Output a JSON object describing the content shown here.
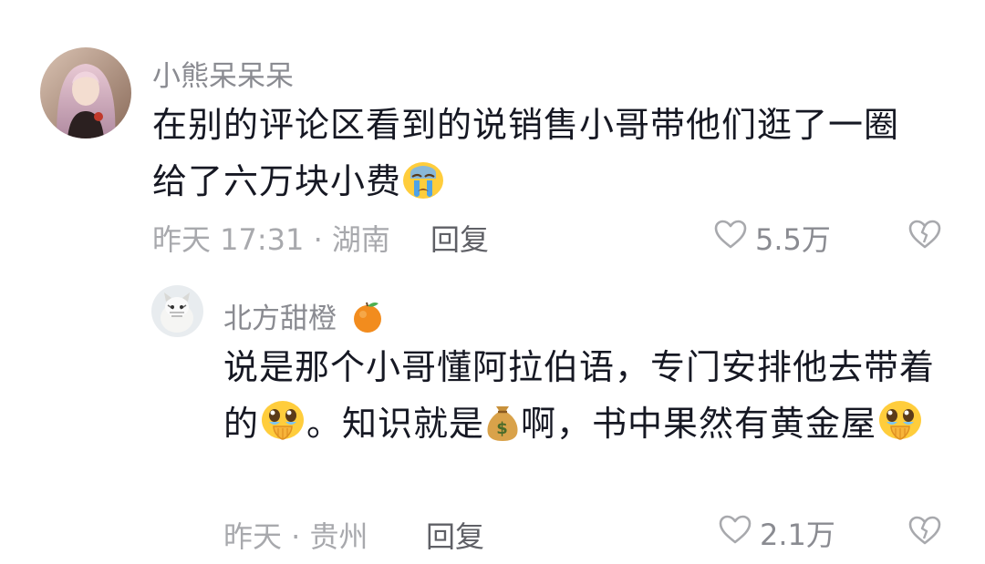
{
  "comments": [
    {
      "username": "小熊呆呆呆",
      "text_parts": [
        "在别的评论区看到的说销售小哥带他们逛了一圈给了六万块小费"
      ],
      "emoji": "crying-face-emoji",
      "meta": "昨天 17:31 · 湖南",
      "reply_label": "回复",
      "like_count": "5.5万"
    },
    {
      "username": "北方甜橙",
      "username_emoji": "orange-emoji",
      "text_part1": "说是那个小哥懂阿拉伯语，专门安排他去带着的",
      "text_part2": "。知识就是",
      "text_part3": "啊，书中果然有黄金屋",
      "emoji_a": "pleading-face-emoji",
      "emoji_b": "money-bag-emoji",
      "meta": "昨天 · 贵州",
      "reply_label": "回复",
      "like_count": "2.1万"
    }
  ],
  "colors": {
    "username": "#8a8b91",
    "text": "#161823",
    "meta": "#a8a9ad",
    "reply": "#5f6066"
  }
}
